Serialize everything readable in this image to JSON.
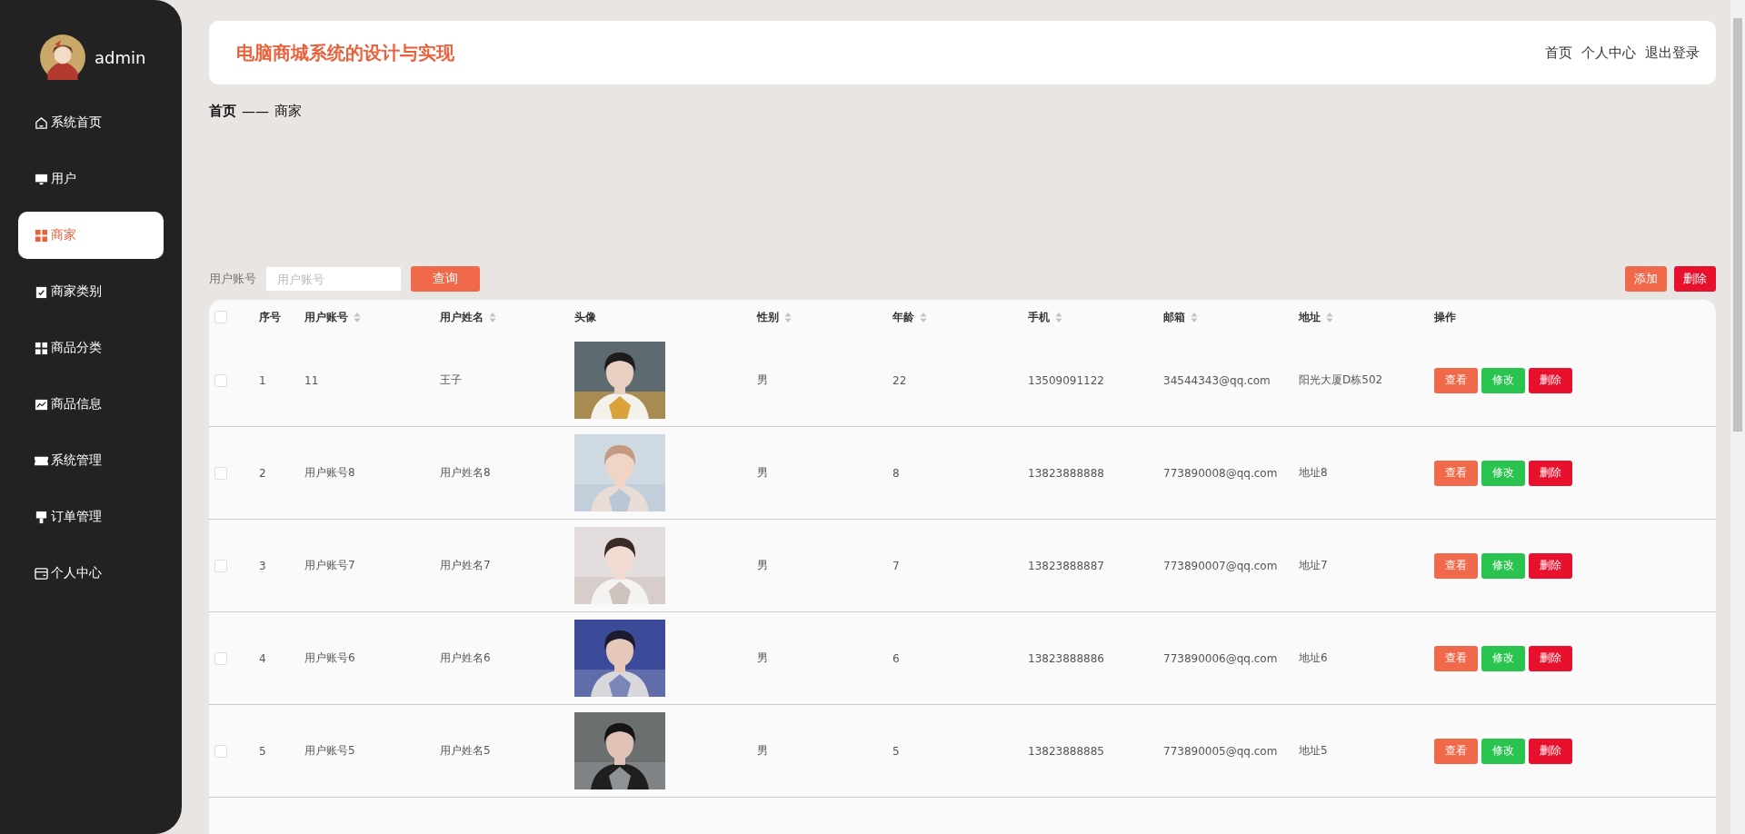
{
  "sidebar": {
    "user": "admin",
    "items": [
      {
        "label": "系统首页",
        "selected": false
      },
      {
        "label": "用户",
        "selected": false
      },
      {
        "label": "商家",
        "selected": true
      },
      {
        "label": "商家类别",
        "selected": false
      },
      {
        "label": "商品分类",
        "selected": false
      },
      {
        "label": "商品信息",
        "selected": false
      },
      {
        "label": "系统管理",
        "selected": false
      },
      {
        "label": "订单管理",
        "selected": false
      },
      {
        "label": "个人中心",
        "selected": false
      }
    ]
  },
  "header": {
    "title": "电脑商城系统的设计与实现",
    "links": [
      "首页",
      "个人中心",
      "退出登录"
    ]
  },
  "breadcrumb": {
    "home": "首页",
    "separator": "——",
    "current": "商家"
  },
  "search": {
    "label": "用户账号",
    "placeholder": "用户账号",
    "button": "查询"
  },
  "actions": [
    {
      "label": "添加",
      "kind": "add"
    },
    {
      "label": "删除",
      "kind": "delete"
    }
  ],
  "table": {
    "select_all": {
      "checked": false
    },
    "columns": [
      {
        "label": "序号",
        "sortable": false
      },
      {
        "label": "用户账号",
        "sortable": true
      },
      {
        "label": "用户姓名",
        "sortable": true
      },
      {
        "label": "头像",
        "sortable": false
      },
      {
        "label": "性别",
        "sortable": true
      },
      {
        "label": "年龄",
        "sortable": true
      },
      {
        "label": "手机",
        "sortable": true
      },
      {
        "label": "邮箱",
        "sortable": true
      },
      {
        "label": "地址",
        "sortable": true
      },
      {
        "label": "操作",
        "sortable": false
      }
    ],
    "rows": [
      {
        "checked": false,
        "no": "1",
        "account": "11",
        "name": "王子",
        "gender": "男",
        "age": "22",
        "phone": "13509091122",
        "email": "34544343@qq.com",
        "address": "阳光大厦D栋502",
        "buttons": [
          {
            "label": "查看",
            "kind": "view"
          },
          {
            "label": "修改",
            "kind": "edit"
          },
          {
            "label": "删除",
            "kind": "delete"
          }
        ]
      },
      {
        "checked": false,
        "no": "2",
        "account": "用户账号8",
        "name": "用户姓名8",
        "gender": "男",
        "age": "8",
        "phone": "13823888888",
        "email": "773890008@qq.com",
        "address": "地址8",
        "buttons": [
          {
            "label": "查看",
            "kind": "view"
          },
          {
            "label": "修改",
            "kind": "edit"
          },
          {
            "label": "删除",
            "kind": "delete"
          }
        ]
      },
      {
        "checked": false,
        "no": "3",
        "account": "用户账号7",
        "name": "用户姓名7",
        "gender": "男",
        "age": "7",
        "phone": "13823888887",
        "email": "773890007@qq.com",
        "address": "地址7",
        "buttons": [
          {
            "label": "查看",
            "kind": "view"
          },
          {
            "label": "修改",
            "kind": "edit"
          },
          {
            "label": "删除",
            "kind": "delete"
          }
        ]
      },
      {
        "checked": false,
        "no": "4",
        "account": "用户账号6",
        "name": "用户姓名6",
        "gender": "男",
        "age": "6",
        "phone": "13823888886",
        "email": "773890006@qq.com",
        "address": "地址6",
        "buttons": [
          {
            "label": "查看",
            "kind": "view"
          },
          {
            "label": "修改",
            "kind": "edit"
          },
          {
            "label": "删除",
            "kind": "delete"
          }
        ]
      },
      {
        "checked": false,
        "no": "5",
        "account": "用户账号5",
        "name": "用户姓名5",
        "gender": "男",
        "age": "5",
        "phone": "13823888885",
        "email": "773890005@qq.com",
        "address": "地址5",
        "buttons": [
          {
            "label": "查看",
            "kind": "view"
          },
          {
            "label": "修改",
            "kind": "edit"
          },
          {
            "label": "删除",
            "kind": "delete"
          }
        ]
      }
    ]
  }
}
